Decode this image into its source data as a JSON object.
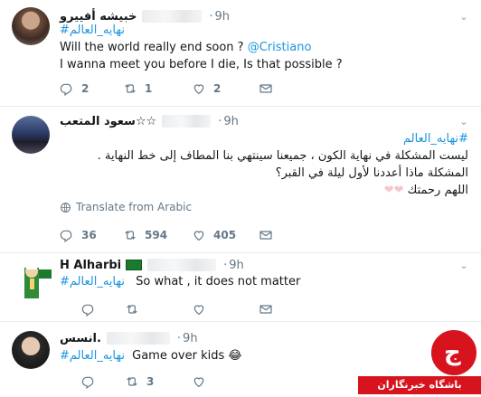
{
  "tweets": [
    {
      "name": "خبيشه أفييرو",
      "time": "9h",
      "hashtag": "#نهايه_العالم",
      "line1_prefix": "Will the world really end soon ?",
      "mention": "@Cristiano",
      "line2": "I wanna meet you before I die, Is that possible ?",
      "reply_count": "2",
      "retweet_count": "1",
      "like_count": "2"
    },
    {
      "name": "سعود المتعب☆☆",
      "time": "9h",
      "hashtag": "#نهايه_العالم",
      "line1": "ليست المشكلة في نهاية الكون ، جميعنا سينتهي بنا المطاف إلى خط النهاية .",
      "line2": "المشكلة ماذا أعددنا لأول ليلة في القبر؟",
      "line3": "اللهم رحمتك",
      "translate_label": "Translate from Arabic",
      "reply_count": "36",
      "retweet_count": "594",
      "like_count": "405"
    },
    {
      "name": "H Alharbi",
      "flag": "saudi-flag",
      "time": "9h",
      "hashtag": "#نهايه_العالم",
      "text": "So what , it does not matter"
    },
    {
      "name": "انسس.",
      "time": "9h",
      "hashtag": "#نهايه_العالم",
      "text": "Game over kids 😂",
      "retweet_count": "3"
    }
  ],
  "watermark": {
    "label": "باشگاه خبرنگاران",
    "colors": {
      "red": "#d7141e",
      "dark": "#3a3a3a"
    }
  },
  "colors": {
    "link": "#1b95e0",
    "muted": "#657786",
    "divider": "#e6ecf0"
  }
}
